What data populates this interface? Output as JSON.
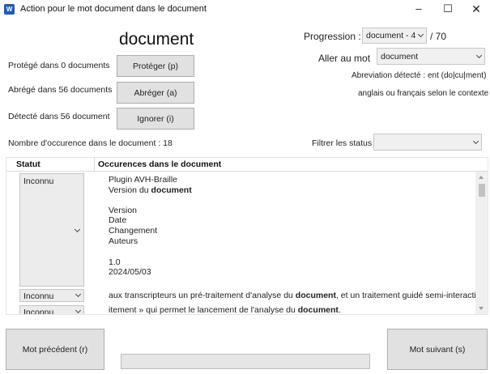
{
  "window": {
    "title": "Action pour le mot document dans le document",
    "app_icon": "word-icon",
    "min_icon": "–",
    "max_icon": "☐",
    "close_icon": "✕"
  },
  "word": "document",
  "actions": {
    "protected_label": "Protégé dans 0 documents",
    "abbreviated_label": "Abrégé dans 56 documents",
    "detected_label": "Détecté dans 56 document",
    "protect_button": "Protéger (p)",
    "abbreviate_button": "Abréger (a)",
    "ignore_button": "Ignorer (i)"
  },
  "progression": {
    "label": "Progression :",
    "value": "document - 4",
    "total": "/ 70"
  },
  "goto": {
    "label": "Aller au mot",
    "value": "document"
  },
  "abbreviation_detected": "Abreviation détecté : ent (do|cu|ment)",
  "language_note": "anglais ou français selon le contexte",
  "occurrence_count": "Nombre d'occurence dans le document : 18",
  "filter": {
    "label": "Filtrer les status",
    "value": ""
  },
  "grid": {
    "headers": [
      "Statut",
      "Occurences dans le document"
    ],
    "rows": [
      {
        "status": "Inconnu",
        "lines": [
          [
            "Plugin AVH-Braille",
            "",
            ""
          ],
          [
            "Version du ",
            "document",
            ""
          ],
          [
            "",
            "",
            ""
          ],
          [
            "Version",
            "",
            ""
          ],
          [
            "Date",
            "",
            ""
          ],
          [
            "Changement",
            "",
            ""
          ],
          [
            "Auteurs",
            "",
            ""
          ],
          [
            "",
            "",
            ""
          ],
          [
            "1.0",
            "",
            ""
          ],
          [
            "2024/05/03",
            "",
            ""
          ]
        ]
      },
      {
        "status": "Inconnu",
        "lines": [
          [
            "aux transcripteurs un pré-traitement d'analyse du ",
            "document",
            ", et un traitement guidé semi-interactif pour"
          ]
        ]
      },
      {
        "status": "Inconnu",
        "lines": [
          [
            "itement » qui permet le lancement de l'analyse du ",
            "document",
            "."
          ]
        ]
      }
    ]
  },
  "footer": {
    "prev_button": "Mot précédent (r)",
    "next_button": "Mot suivant (s)",
    "progress_fraction": 0
  }
}
